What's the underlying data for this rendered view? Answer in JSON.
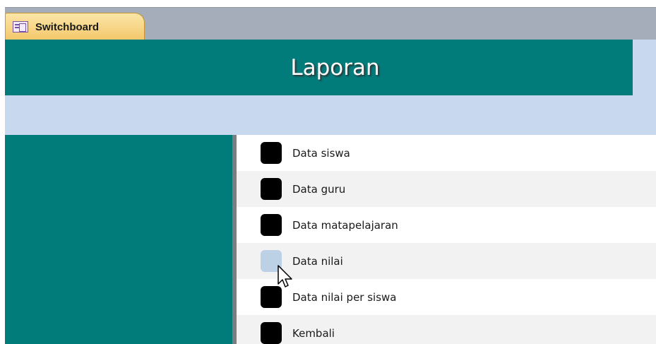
{
  "tab": {
    "label": "Switchboard",
    "icon": "form-icon"
  },
  "header": {
    "title": "Laporan"
  },
  "colors": {
    "header_bg": "#027b7b",
    "form_bg": "#c7d8ef",
    "tab_bg": "#f4c76a"
  },
  "items": [
    {
      "label": "Data siswa",
      "state": "normal"
    },
    {
      "label": "Data guru",
      "state": "normal"
    },
    {
      "label": "Data matapelajaran",
      "state": "normal"
    },
    {
      "label": "Data nilai",
      "state": "hover"
    },
    {
      "label": "Data nilai per siswa",
      "state": "normal"
    },
    {
      "label": "Kembali",
      "state": "normal"
    }
  ]
}
